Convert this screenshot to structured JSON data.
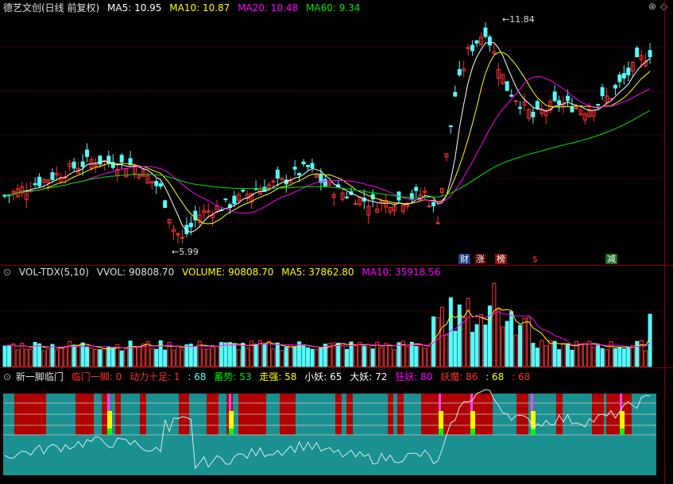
{
  "price": {
    "title": "德艺文创(日线 前复权)",
    "ma5": "MA5: 10.95",
    "ma10": "MA10: 10.87",
    "ma20": "MA20: 10.48",
    "ma60": "MA60: 9.34",
    "high_label": "11.84",
    "low_label": "5.99",
    "tags": [
      "财",
      "涨",
      "榜",
      "$",
      "减"
    ]
  },
  "volume": {
    "title": "VOL-TDX(5,10)",
    "vvol": "VVOL: 90808.70",
    "volume": "VOLUME: 90808.70",
    "ma5": "MA5: 37862.80",
    "ma10": "MA10: 35918.56"
  },
  "indicator": {
    "title": "新一脚临门",
    "lin": "临门一脚: 0",
    "dongli": "动力十足: 1",
    "v68a": ": 68",
    "xushi": "蓄势: 53",
    "zouqiang": "走强: 58",
    "xiaoyao": "小妖: 65",
    "dayao": "大妖: 72",
    "kuangyao": "狂妖: 80",
    "yaomo": "妖魔: 86",
    "v68b": ": 68",
    "v68c": ": 68"
  },
  "colors": {
    "up": "#ff3232",
    "down": "#54fcfc",
    "ma5": "#ffffff",
    "ma10": "#ffff00",
    "ma20": "#ff00ff",
    "ma60": "#00e600"
  }
}
